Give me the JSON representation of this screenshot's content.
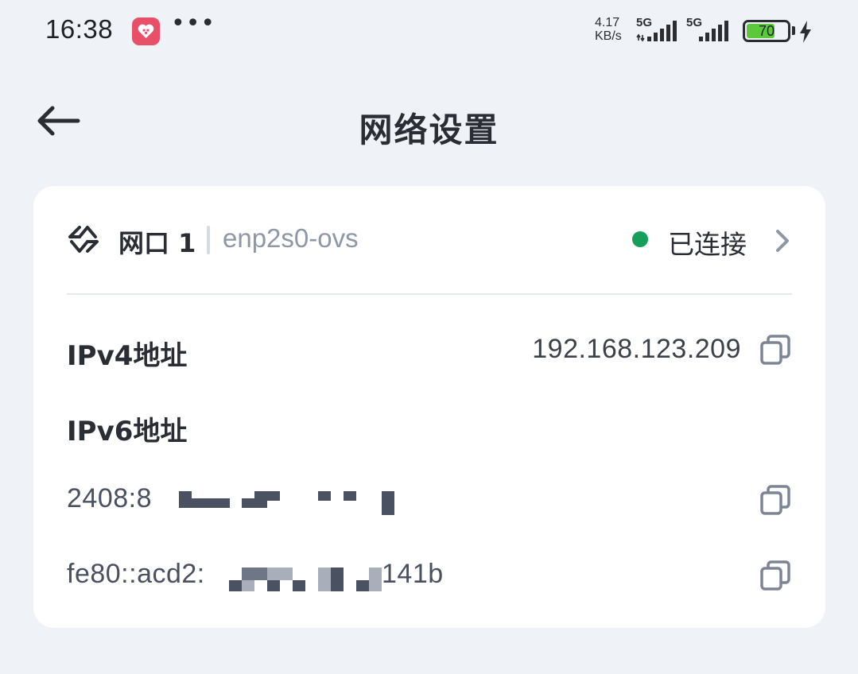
{
  "status_bar": {
    "time": "16:38",
    "more_dots": "•••",
    "net_speed_value": "4.17",
    "net_speed_unit": "KB/s",
    "signal_1_label": "5G",
    "signal_2_label": "5G",
    "battery_level": 70,
    "battery_text": "70",
    "icons": [
      "app-notification-icon",
      "signal-5g-icon",
      "battery-icon",
      "charging-bolt-icon"
    ]
  },
  "header": {
    "title": "网络设置",
    "back_icon": "arrow-left-icon"
  },
  "port": {
    "name": "网口 1",
    "interface": "enp2s0-ovs",
    "status": "已连接",
    "status_color": "#14a05c"
  },
  "ipv4": {
    "label": "IPv4地址",
    "value": "192.168.123.209"
  },
  "ipv6": {
    "label": "IPv6地址",
    "addresses": [
      {
        "value": "2408:8"
      },
      {
        "value": "fe80::acd2:",
        "suffix": "141b"
      }
    ]
  },
  "colors": {
    "background": "#eff2f7",
    "card": "#ffffff",
    "accent_green": "#14a05c",
    "battery_fill": "#5cc93a",
    "app_icon": "#ea4f6a"
  }
}
